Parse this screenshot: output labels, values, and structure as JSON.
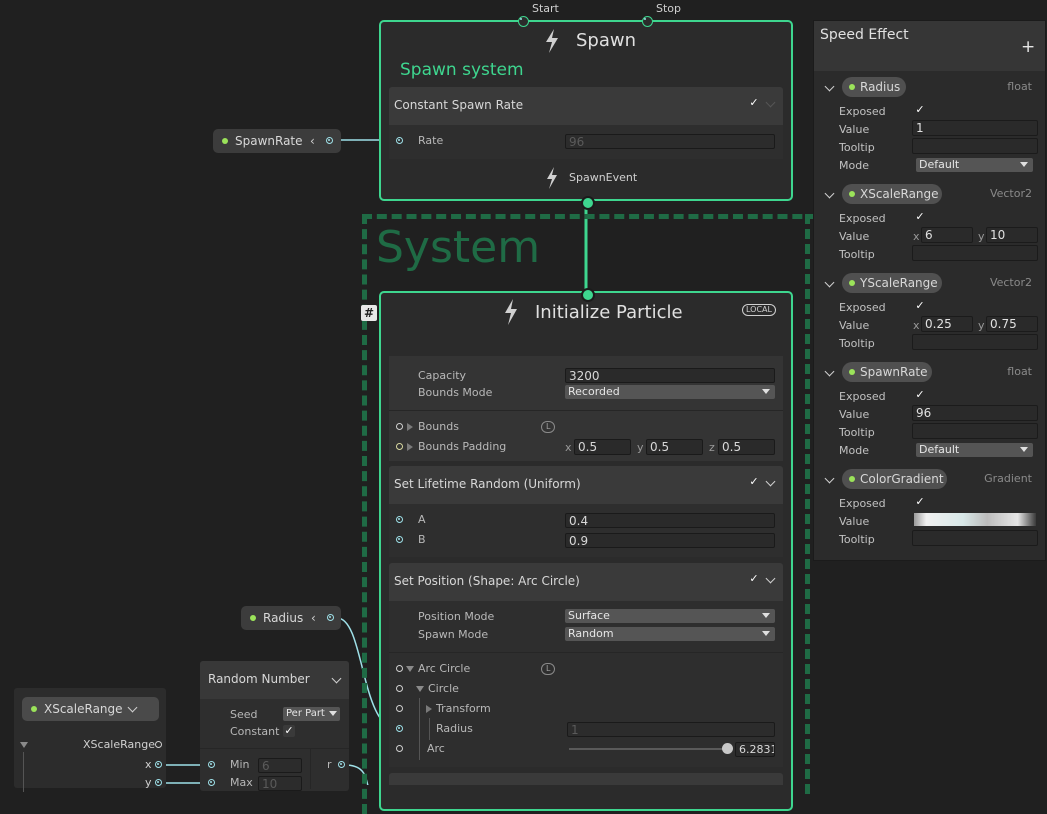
{
  "spawn_context": {
    "start_label": "Start",
    "stop_label": "Stop",
    "title": "Spawn",
    "subtitle": "Spawn system",
    "block_title": "Constant Spawn Rate",
    "rate_label": "Rate",
    "rate_value": "96",
    "event_label": "SpawnEvent"
  },
  "system": {
    "title": "System",
    "hash_label": "#"
  },
  "init_context": {
    "title": "Initialize Particle",
    "space_badge": "LOCAL",
    "capacity_label": "Capacity",
    "capacity_value": "3200",
    "bounds_mode_label": "Bounds Mode",
    "bounds_mode_value": "Recorded",
    "bounds_label": "Bounds",
    "bounds_badge": "L",
    "bounds_padding_label": "Bounds Padding",
    "bp_x_label": "x",
    "bp_x": "0.5",
    "bp_y_label": "y",
    "bp_y": "0.5",
    "bp_z_label": "z",
    "bp_z": "0.5",
    "lifetime_title": "Set Lifetime Random (Uniform)",
    "a_label": "A",
    "a_value": "0.4",
    "b_label": "B",
    "b_value": "0.9",
    "position_title": "Set Position (Shape: Arc Circle)",
    "position_mode_label": "Position Mode",
    "position_mode_value": "Surface",
    "spawn_mode_label": "Spawn Mode",
    "spawn_mode_value": "Random",
    "arc_circle_label": "Arc Circle",
    "arc_circle_badge": "L",
    "circle_label": "Circle",
    "transform_label": "Transform",
    "radius_label": "Radius",
    "radius_value": "1",
    "arc_label": "Arc",
    "arc_value": "6.2831"
  },
  "prop_nodes": {
    "spawnrate": "SpawnRate",
    "radius": "Radius"
  },
  "random_number": {
    "title": "Random Number",
    "seed_label": "Seed",
    "seed_value": "Per Part",
    "constant_label": "Constant",
    "min_label": "Min",
    "min_value": "6",
    "max_label": "Max",
    "max_value": "10",
    "r_label": "r"
  },
  "xscale_node": {
    "title": "XScaleRange",
    "row_label": "XScaleRange",
    "x_label": "x",
    "y_label": "y"
  },
  "blackboard": {
    "title": "Speed Effect",
    "add_label": "+",
    "properties": [
      {
        "name": "Radius",
        "type": "float",
        "exposed_label": "Exposed",
        "value_label": "Value",
        "value": "1",
        "tooltip_label": "Tooltip",
        "mode_label": "Mode",
        "mode_value": "Default"
      },
      {
        "name": "XScaleRange",
        "type": "Vector2",
        "exposed_label": "Exposed",
        "value_label": "Value",
        "x_label": "x",
        "x": "6",
        "y_label": "y",
        "y": "10",
        "tooltip_label": "Tooltip"
      },
      {
        "name": "YScaleRange",
        "type": "Vector2",
        "exposed_label": "Exposed",
        "value_label": "Value",
        "x_label": "x",
        "x": "0.25",
        "y_label": "y",
        "y": "0.75",
        "tooltip_label": "Tooltip"
      },
      {
        "name": "SpawnRate",
        "type": "float",
        "exposed_label": "Exposed",
        "value_label": "Value",
        "value": "96",
        "tooltip_label": "Tooltip",
        "mode_label": "Mode",
        "mode_value": "Default"
      },
      {
        "name": "ColorGradient",
        "type": "Gradient",
        "exposed_label": "Exposed",
        "value_label": "Value",
        "tooltip_label": "Tooltip"
      }
    ]
  },
  "colors": {
    "background": "#202020",
    "context_border": "#3ed68f",
    "system_frame": "#1f6b45",
    "link": "#9ee0e8",
    "property_dot": "#9be35a"
  }
}
